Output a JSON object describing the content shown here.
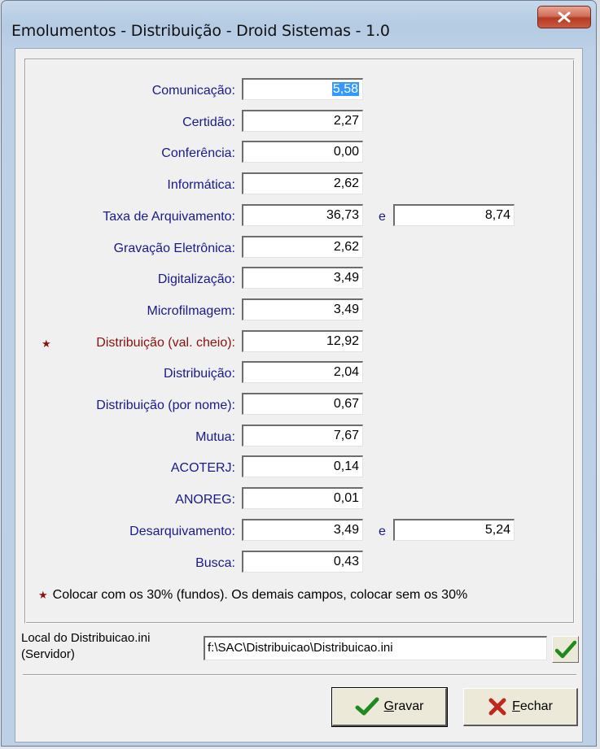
{
  "window": {
    "title": "Emolumentos - Distribuição - Droid Sistemas - 1.0",
    "close_label": "X"
  },
  "fields": [
    {
      "label": "Comunicação:",
      "value": "5,58",
      "selected": true
    },
    {
      "label": "Certidão:",
      "value": "2,27"
    },
    {
      "label": "Conferência:",
      "value": "0,00"
    },
    {
      "label": "Informática:",
      "value": "2,62"
    },
    {
      "label": "Taxa de Arquivamento:",
      "value": "36,73",
      "connector": "e",
      "value2": "8,74"
    },
    {
      "label": "Gravação Eletrônica:",
      "value": "2,62"
    },
    {
      "label": "Digitalização:",
      "value": "3,49"
    },
    {
      "label": "Microfilmagem:",
      "value": "3,49"
    },
    {
      "label": "Distribuição (val. cheio):",
      "value": "12,92",
      "starred": true
    },
    {
      "label": "Distribuição:",
      "value": "2,04"
    },
    {
      "label": "Distribuição (por nome):",
      "value": "0,67"
    },
    {
      "label": "Mutua:",
      "value": "7,67"
    },
    {
      "label": "ACOTERJ:",
      "value": "0,14"
    },
    {
      "label": "ANOREG:",
      "value": "0,01"
    },
    {
      "label": "Desarquivamento:",
      "value": "3,49",
      "connector": "e",
      "value2": "5,24"
    },
    {
      "label": "Busca:",
      "value": "0,43"
    }
  ],
  "star_glyph": "★",
  "note": "Colocar com os 30% (fundos). Os demais campos, colocar sem os 30%",
  "path": {
    "label_line1": "Local do Distribuicao.ini",
    "label_line2": "(Servidor)",
    "value": "f:\\SAC\\Distribuicao\\Distribuicao.ini"
  },
  "buttons": {
    "save": {
      "accel": "G",
      "rest": "ravar"
    },
    "close": {
      "accel": "F",
      "rest": "echar"
    }
  },
  "colors": {
    "label_blue": "#1a1a8c",
    "label_red": "#8b1010",
    "check_green": "#1f8a1f",
    "close_red": "#c0281c"
  }
}
